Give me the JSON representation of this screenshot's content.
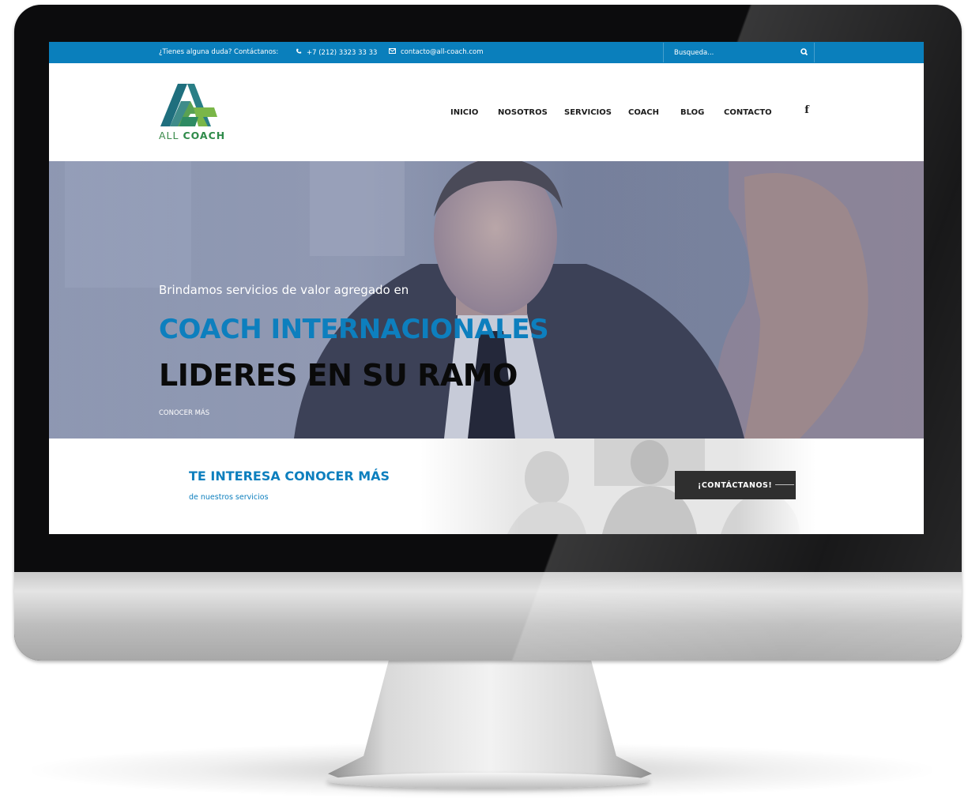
{
  "topbar": {
    "question": "¿Tienes alguna duda? Contáctanos:",
    "phone": "+7 (212) 3323 33 33",
    "email": "contacto@all-coach.com",
    "search_placeholder": "Busqueda..."
  },
  "brand": {
    "logo_word1": "ALL",
    "logo_word2": "COACH"
  },
  "nav": [
    {
      "label": "INICIO"
    },
    {
      "label": "NOSOTROS"
    },
    {
      "label": "SERVICIOS"
    },
    {
      "label": "COACH"
    },
    {
      "label": "BLOG"
    },
    {
      "label": "CONTACTO"
    }
  ],
  "social": {
    "facebook_glyph": "f"
  },
  "hero": {
    "intro": "Brindamos servicios de valor agregado en",
    "headline_blue": "COACH INTERNACIONALES",
    "headline_black": "LIDERES EN SU RAMO",
    "link": "CONOCER MÁS"
  },
  "cta": {
    "title": "TE INTERESA CONOCER MÁS",
    "subtitle": "de nuestros servicios",
    "button": "¡CONTÁCTANOS!"
  },
  "colors": {
    "brand_blue": "#0a7fbc",
    "brand_green": "#3a8a4a",
    "cta_button": "#2f2f2f"
  },
  "icons": [
    "phone-icon",
    "envelope-icon",
    "search-icon",
    "facebook-icon"
  ]
}
